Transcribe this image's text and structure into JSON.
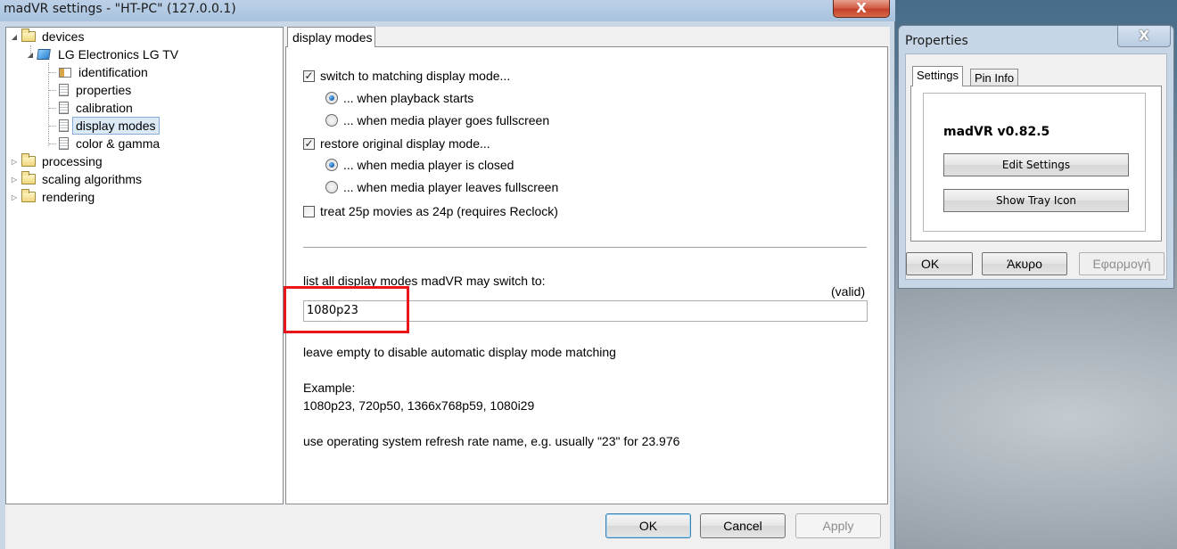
{
  "main_window": {
    "title": "madVR settings - \"HT-PC\" (127.0.0.1)",
    "close_glyph": "X"
  },
  "tree": {
    "devices": "devices",
    "device_name": "LG Electronics LG TV",
    "identification": "identification",
    "properties": "properties",
    "calibration": "calibration",
    "display_modes": "display modes",
    "color_gamma": "color & gamma",
    "processing": "processing",
    "scaling": "scaling algorithms",
    "rendering": "rendering"
  },
  "panel": {
    "tab_label": "display modes",
    "switch_matching": "switch to matching display mode...",
    "switch_matching_checked": true,
    "when_playback_starts": "... when playback starts",
    "when_fullscreen": "... when media player goes fullscreen",
    "restore_original": "restore original display mode...",
    "restore_original_checked": true,
    "when_closed": "... when media player is closed",
    "when_leaves_fullscreen": "... when media player leaves fullscreen",
    "treat_25p": "treat 25p movies as 24p  (requires Reclock)",
    "treat_25p_checked": false,
    "list_label": "list all display modes madVR may switch to:",
    "valid_status": "(valid)",
    "modes_value": "1080p23",
    "leave_empty": "leave empty to disable automatic display mode matching",
    "example_label": "Example:",
    "example_values": "1080p23, 720p50, 1366x768p59, 1080i29",
    "refresh_note": "use operating system refresh rate name, e.g. usually \"23\" for 23.976",
    "check_glyph": "✓"
  },
  "buttons": {
    "ok": "OK",
    "cancel": "Cancel",
    "apply": "Apply"
  },
  "properties_window": {
    "title": "Properties",
    "close_glyph": "X",
    "tab_settings": "Settings",
    "tab_pin_info": "Pin Info",
    "version": "madVR v0.82.5",
    "edit_settings": "Edit Settings",
    "show_tray_icon": "Show Tray Icon",
    "ok": "OK",
    "cancel_greek": "Άκυρο",
    "apply_greek": "Εφαρμογή"
  },
  "colors": {
    "highlight_red": "#e8161b",
    "titlebar_blue": "#bcd1e8",
    "close_red": "#c4412a"
  }
}
